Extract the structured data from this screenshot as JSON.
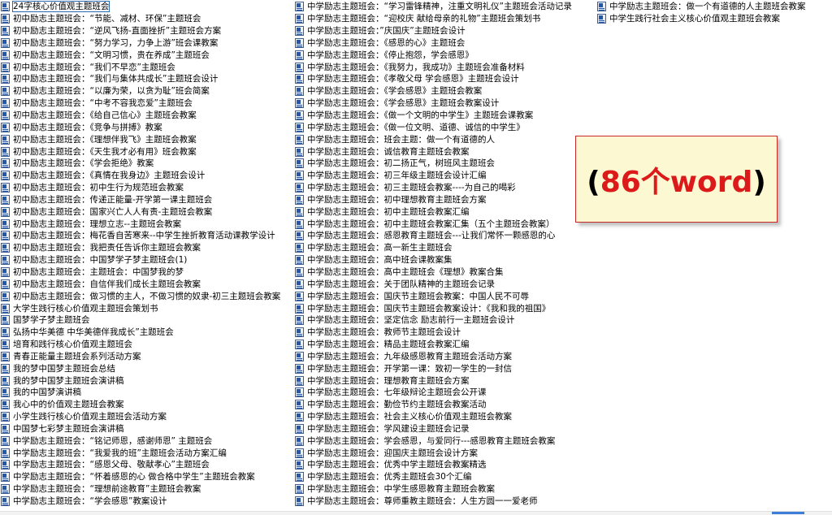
{
  "files": {
    "columns": [
      [
        "24字核心价值观主题班会",
        "初中励志主题班会：“节能、减材、环保”主题班会",
        "初中励志主题班会：“逆风飞扬-直面挫折”主题班会方案",
        "初中励志主题班会：“努力学习，力争上游”班会课教案",
        "初中励志主题班会：“文明习惯，贵在养成”主题班会",
        "初中励志主题班会：“我们不早恋”主题班会",
        "初中励志主题班会：“我们与集体共成长”主题班会设计",
        "初中励志主题班会：“以廉为荣，以贪为耻”班会简案",
        "初中励志主题班会：“中考不容我恋爱”主题班会",
        "初中励志主题班会：《给自己信心》主题班会教案",
        "初中励志主题班会：《竞争与拼搏》教案",
        "初中励志主题班会：《理想伴我飞》主题班会教案",
        "初中励志主题班会：《天生我才必有用》班会教案",
        "初中励志主题班会：《学会拒绝》教案",
        "初中励志主题班会：《真情在我身边》主题班会设计",
        "初中励志主题班会：初中生行为规范班会教案",
        "初中励志主题班会：传递正能量-开学第一课主题班会",
        "初中励志主题班会：国家兴亡人人有责-主题班会教案",
        "初中励志主题班会：理想立志--主题班会教案",
        "初中励志主题班会：梅花香自苦寒来--中学生挫折教育活动课教学设计",
        "初中励志主题班会：我把责任告诉你主题班会教案",
        "初中励志主题班会：中国梦学子梦主题班会(1)",
        "初中励志主题班会：主题班会：中国梦我的梦",
        "初中励志主题班会：自信伴我们成长主题班会教案",
        "初中励志主题班会：做习惯的主人，不做习惯的奴隶-初三主题班会教案",
        "大学生践行核心价值观主题班会策划书",
        "国梦学子梦主题班会",
        "弘扬中华美德 中华美德伴我成长”主题班会",
        "培育和践行核心价值观主题班会",
        "青春正能量主题班会系列活动方案",
        "我的梦中国梦主题班会总结",
        "我的梦中国梦主题班会演讲稿",
        "我的中国梦演讲稿",
        "我心中的价值观主题班会教案",
        "小学生践行核心价值观主题班会活动方案",
        "中国梦七彩梦主题班会演讲稿",
        "中学励志主题班会：“铭记师恩，感谢师恩” 主题班会",
        "中学励志主题班会：“我爱我的班”主题班会活动方案汇编",
        "中学励志主题班会：“感恩父母、敬献孝心”主题班会",
        "中学励志主题班会：“怀着感恩的心 做合格中学生”主题班会教案",
        "中学励志主题班会：“理想前途教育”主题班会教案",
        "中学励志主题班会：“学会感恩”教案设计"
      ],
      [
        "中学励志主题班会：“学习雷锋精神，注重文明礼仪”主题班会活动记录",
        "中学励志主题班会：“迎校庆 献给母亲的礼物”主题班会策划书",
        "中学励志主题班会：”庆国庆”主题班会设计",
        "中学励志主题班会：《感恩的心》主题班会",
        "中学励志主题班会：《停止抱怨，学会感恩》",
        "中学励志主题班会：《我努力，我成功》主题班会准备材料",
        "中学励志主题班会：《孝敬父母 学会感恩》主题班会设计",
        "中学励志主题班会：《学会感恩》主题班会教案",
        "中学励志主题班会：《学会感恩》主题班会教案设计",
        "中学励志主题班会：《做一个文明的中学生》主题班会课教案",
        "中学励志主题班会：《做一位文明、道德、诚信的中学生》",
        "中学励志主题班会：班会主题：做一个有道德的人",
        "中学励志主题班会：诚信教育主题班会教案",
        "中学励志主题班会：初二扬正气，树班风主题班会",
        "中学励志主题班会：初三年级主题班会设计汇编",
        "中学励志主题班会：初三主题班会教案----为自己的喝彩",
        "中学励志主题班会：初中理想教育主题班会方案",
        "中学励志主题班会：初中主题班会教案汇编",
        "中学励志主题班会：初中主题班会教案汇集（五个主题班会教案）",
        "中学励志主题班会：感恩教育主题班会---让我们常怀一颗感恩的心",
        "中学励志主题班会：高一新生主题班会",
        "中学励志主题班会：高中班会课教案集",
        "中学励志主题班会：高中主题班会《理想》教案合集",
        "中学励志主题班会：关于团队精神的主题班会记录",
        "中学励志主题班会：国庆节主题班会教案：中国人民不可辱",
        "中学励志主题班会：国庆节主题班会教案设计：《我和我的祖国》",
        "中学励志主题班会：坚定信念 励志前行一主题班会设计",
        "中学励志主题班会：教师节主题班会设计",
        "中学励志主题班会：精品主题班会教案汇编",
        "中学励志主题班会：九年级感恩教育主题班会活动方案",
        "中学励志主题班会：开学第一课：致初一学生的一封信",
        "中学励志主题班会：理想教育主题班会方案",
        "中学励志主题班会：七年级辩论主题班会公开课",
        "中学励志主题班会：勤俭节约主题班会教案活动",
        "中学励志主题班会：社会主义核心价值观主题班会教案",
        "中学励志主题班会：学风建设主题班会记录",
        "中学励志主题班会：学会感恩，与爱同行---感恩教育主题班会教案",
        "中学励志主题班会：迎国庆主题班会设计方案",
        "中学励志主题班会：优秀中学主题班会教案精选",
        "中学励志主题班会：优秀主题班会30个汇编",
        "中学励志主题班会：中学生感恩教育主题班会教案",
        "中学励志主题班会：尊师重教主题班会：人生方圆一一爱老师"
      ],
      [
        "中学励志主题班会：做一个有道德的人主题班会教案",
        "中学生践行社会主义核心价值观主题班会教案"
      ]
    ]
  },
  "callout": {
    "open_paren": "(",
    "count_text": "86个word",
    "close_paren": ")",
    "border_color": "#c9282a",
    "background_color": "#fbf8d2",
    "count_color": "#dc1a1a"
  },
  "icons": {
    "file_icon": "word-document-icon"
  }
}
